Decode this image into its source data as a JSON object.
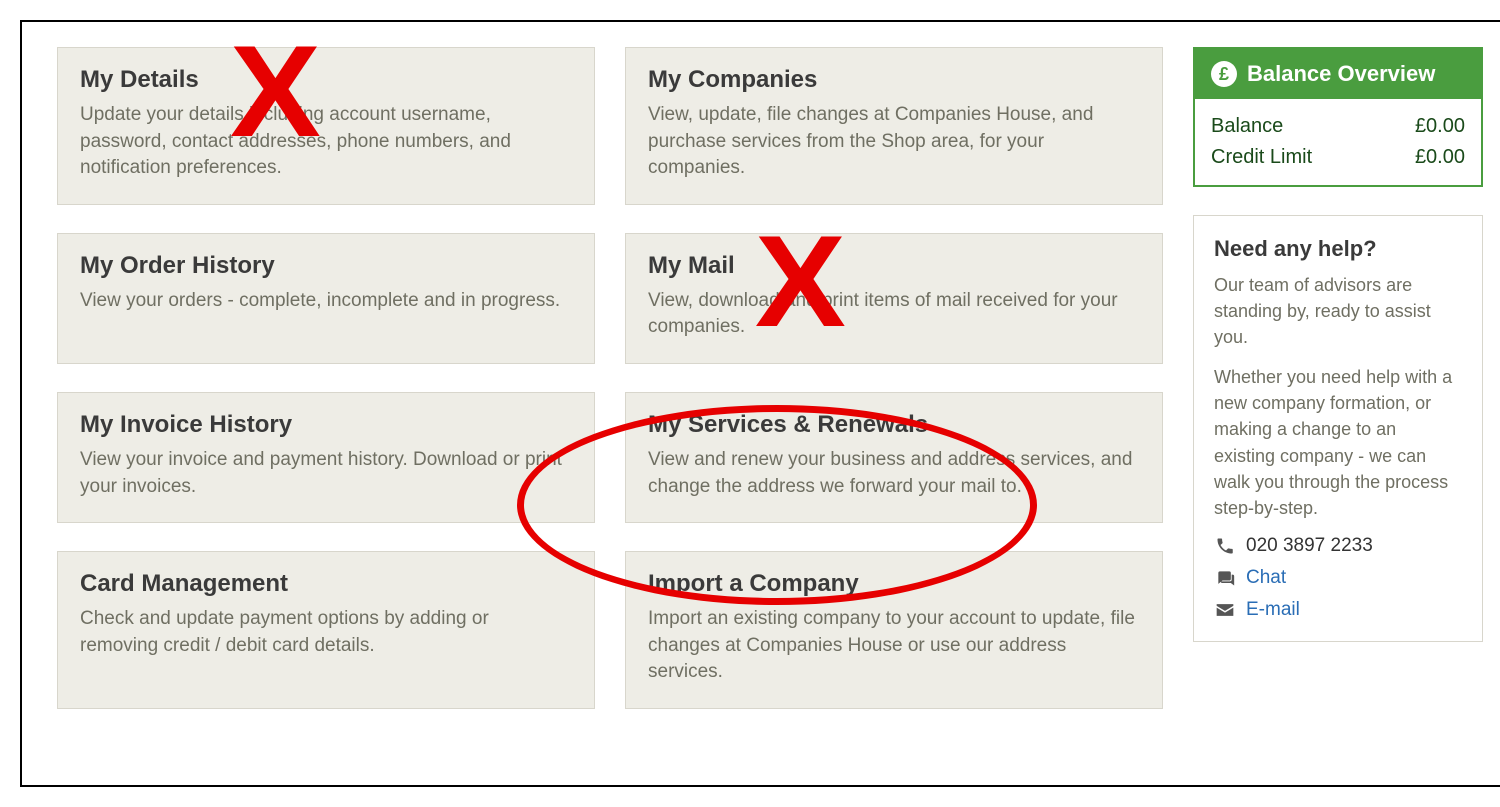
{
  "cards": [
    {
      "title": "My Details",
      "desc": "Update your details including account username, password, contact addresses, phone numbers, and notification preferences."
    },
    {
      "title": "My Companies",
      "desc": "View, update, file changes at Companies House, and purchase services from the Shop area, for your companies."
    },
    {
      "title": "My Order History",
      "desc": "View your orders - complete, incomplete and in progress."
    },
    {
      "title": "My Mail",
      "desc": "View, download and print items of mail received for your companies."
    },
    {
      "title": "My Invoice History",
      "desc": "View your invoice and payment history. Download or print your invoices."
    },
    {
      "title": "My Services & Renewals",
      "desc": "View and renew your business and address services, and change the address we forward your mail to."
    },
    {
      "title": "Card Management",
      "desc": "Check and update payment options by adding or removing credit / debit card details."
    },
    {
      "title": "Import a Company",
      "desc": "Import an existing company to your account to update, file changes at Companies House or use our address services."
    }
  ],
  "balance": {
    "header": "Balance Overview",
    "currency_glyph": "£",
    "rows": [
      {
        "label": "Balance",
        "value": "£0.00"
      },
      {
        "label": "Credit Limit",
        "value": "£0.00"
      }
    ]
  },
  "help": {
    "title": "Need any help?",
    "para1": "Our team of advisors are standing by, ready to assist you.",
    "para2": "Whether you need help with a new company formation, or making a change to an existing company - we can walk you through the process step-by-step.",
    "phone": "020 3897 2233",
    "chat_label": "Chat",
    "email_label": "E-mail"
  },
  "annotations": {
    "x1": "X",
    "x2": "X"
  }
}
